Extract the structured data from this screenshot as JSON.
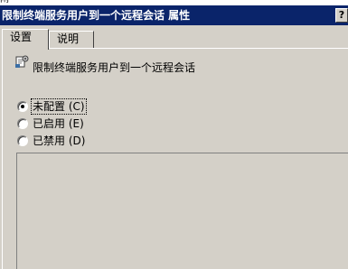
{
  "window": {
    "top_clip_text": "闸",
    "title": "限制终端服务用户到一个远程会话 属性",
    "help_button": "?"
  },
  "tabs": [
    {
      "label": "设置",
      "active": true
    },
    {
      "label": "说明",
      "active": false
    }
  ],
  "policy": {
    "name": "限制终端服务用户到一个远程会话",
    "icon": "policy-setting-icon"
  },
  "options": [
    {
      "label": "未配置 (C)",
      "checked": true
    },
    {
      "label": "已启用 (E)",
      "checked": false
    },
    {
      "label": "已禁用 (D)",
      "checked": false
    }
  ],
  "colors": {
    "titlebar": "#0a246a",
    "face": "#d4d0c8"
  }
}
